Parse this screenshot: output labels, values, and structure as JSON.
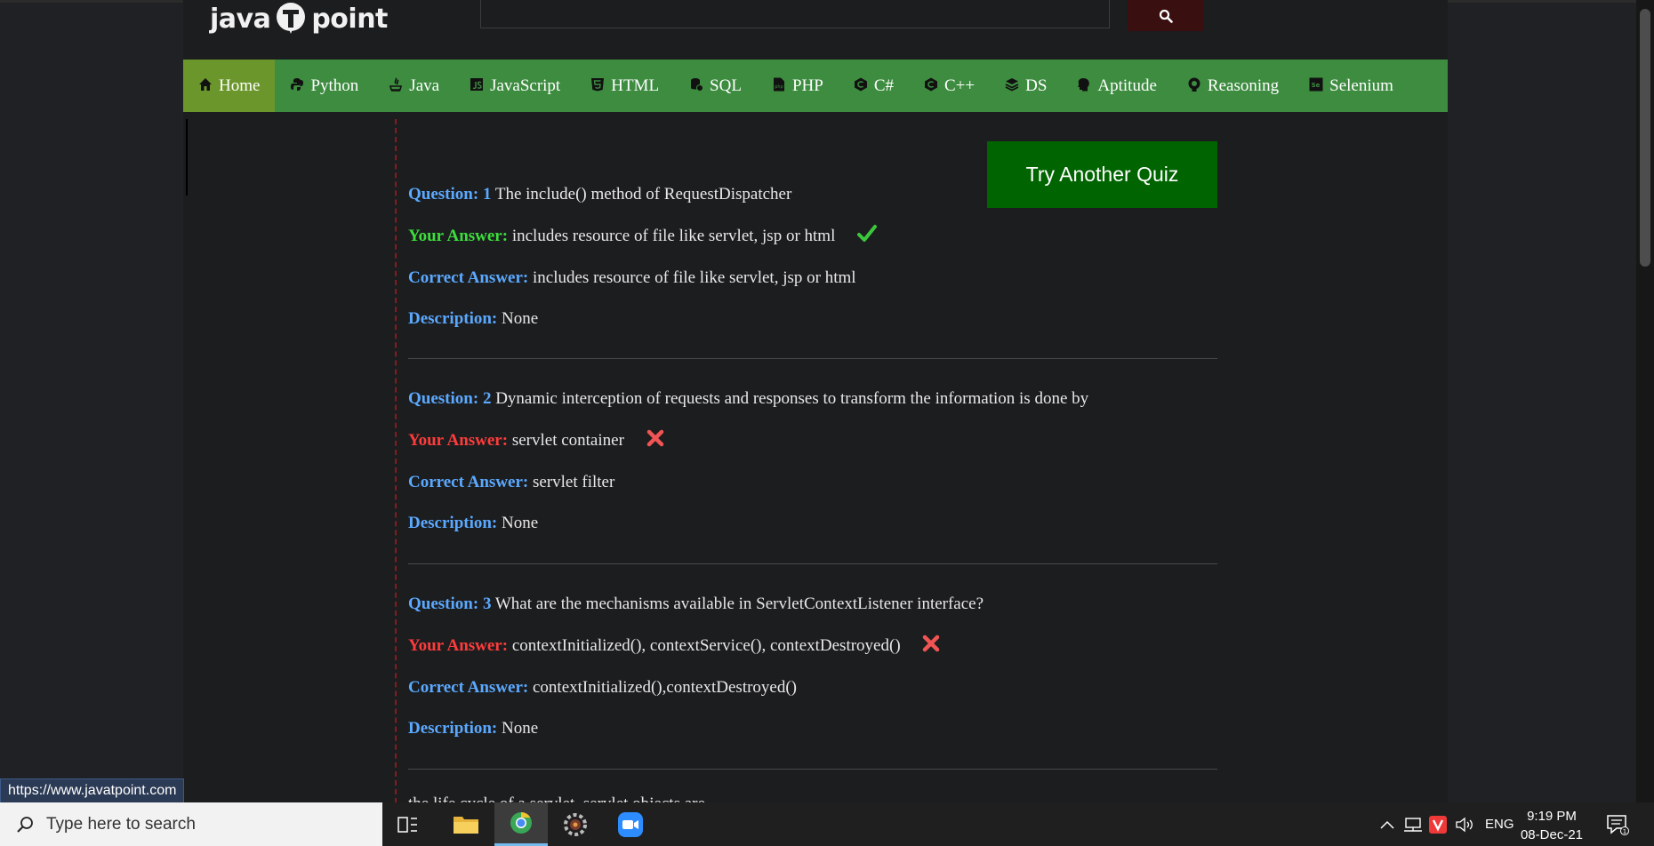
{
  "browser": {
    "status_url": "https://www.javatpoint.com"
  },
  "header": {
    "logo": {
      "part1": "java",
      "part2": "point",
      "alt": "javaTpoint"
    },
    "search": {
      "placeholder": "",
      "button_icon": "search-icon"
    }
  },
  "nav": {
    "items": [
      {
        "label": "Home",
        "icon": "home-icon",
        "active": true
      },
      {
        "label": "Python",
        "icon": "python-icon"
      },
      {
        "label": "Java",
        "icon": "java-icon"
      },
      {
        "label": "JavaScript",
        "icon": "javascript-icon"
      },
      {
        "label": "HTML",
        "icon": "html5-icon"
      },
      {
        "label": "SQL",
        "icon": "sql-icon"
      },
      {
        "label": "PHP",
        "icon": "php-icon"
      },
      {
        "label": "C#",
        "icon": "csharp-icon"
      },
      {
        "label": "C++",
        "icon": "cpp-icon"
      },
      {
        "label": "DS",
        "icon": "ds-icon"
      },
      {
        "label": "Aptitude",
        "icon": "aptitude-icon"
      },
      {
        "label": "Reasoning",
        "icon": "reasoning-icon"
      },
      {
        "label": "Selenium",
        "icon": "selenium-icon"
      }
    ]
  },
  "quiz": {
    "try_another_label": "Try Another Quiz",
    "labels": {
      "question_prefix": "Question:",
      "your_answer": "Your Answer:",
      "correct_answer": "Correct Answer:",
      "description": "Description:"
    },
    "questions": [
      {
        "number": "1",
        "text": "The include() method of RequestDispatcher",
        "your_answer": "includes resource of file like servlet, jsp or html",
        "correct_answer": "includes resource of file like servlet, jsp or html",
        "description": "None",
        "correct": true
      },
      {
        "number": "2",
        "text": "Dynamic interception of requests and responses to transform the information is done by",
        "your_answer": "servlet container",
        "correct_answer": "servlet filter",
        "description": "None",
        "correct": false
      },
      {
        "number": "3",
        "text": "What are the mechanisms available in ServletContextListener interface?",
        "your_answer": "contextInitialized(), contextService(), contextDestroyed()",
        "correct_answer": "contextInitialized(),contextDestroyed()",
        "description": "None",
        "correct": false
      }
    ],
    "partial_next": "the life cycle of a servlet, servlet objects are"
  },
  "colors": {
    "nav_bg": "#3d8c40",
    "nav_active": "#6b962b",
    "quiz_button": "#006400",
    "label_blue": "#5ba9ff",
    "label_green": "#3cde3c",
    "label_red": "#ff3b3b"
  },
  "taskbar": {
    "search_placeholder": "Type here to search",
    "apps": [
      "task-view-icon",
      "file-explorer-icon",
      "chrome-icon",
      "settings-app-icon",
      "zoom-icon"
    ],
    "tray": {
      "language": "ENG",
      "time": "9:19 PM",
      "date": "08-Dec-21",
      "notification_count": "1"
    }
  }
}
